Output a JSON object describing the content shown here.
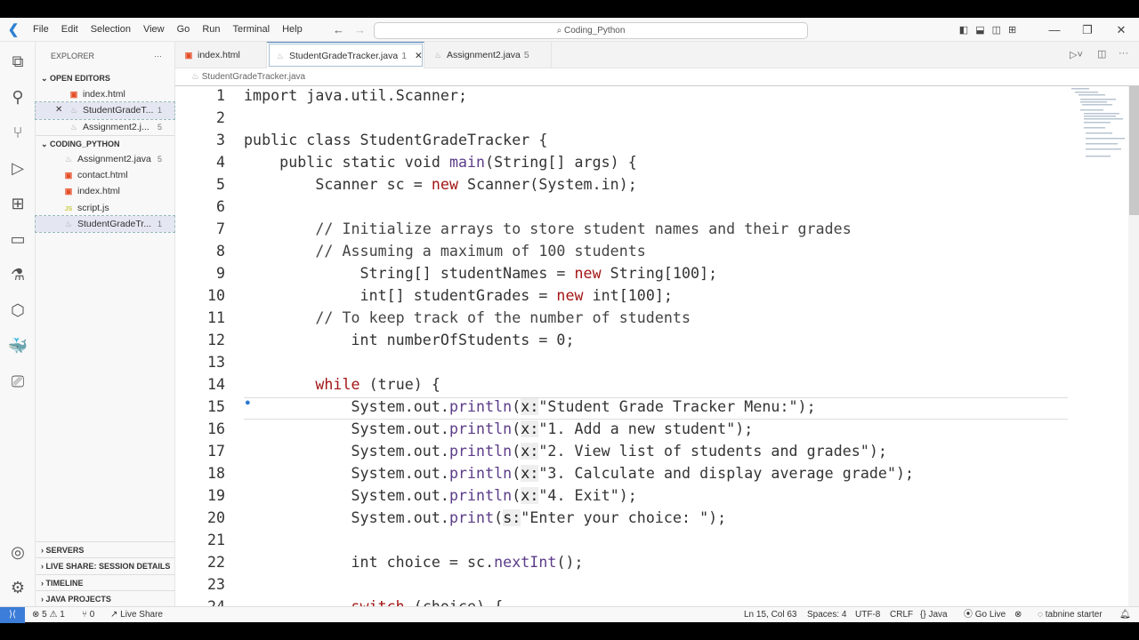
{
  "menu": [
    "File",
    "Edit",
    "Selection",
    "View",
    "Go",
    "Run",
    "Terminal",
    "Help"
  ],
  "search": "Coding_Python",
  "explorer": {
    "title": "EXPLORER",
    "open_editors": "OPEN EDITORS",
    "folder": "CODING_PYTHON",
    "open": [
      {
        "name": "index.html",
        "type": "html",
        "badge": ""
      },
      {
        "name": "StudentGradeT...",
        "type": "java",
        "badge": "1"
      },
      {
        "name": "Assignment2.j...",
        "type": "java",
        "badge": "5"
      }
    ],
    "files": [
      {
        "name": "Assignment2.java",
        "type": "java",
        "badge": "5"
      },
      {
        "name": "contact.html",
        "type": "html",
        "badge": ""
      },
      {
        "name": "index.html",
        "type": "html",
        "badge": ""
      },
      {
        "name": "script.js",
        "type": "js",
        "badge": ""
      },
      {
        "name": "StudentGradeTr...",
        "type": "java",
        "badge": "1"
      }
    ],
    "bottom": [
      "SERVERS",
      "LIVE SHARE: SESSION DETAILS",
      "TIMELINE",
      "JAVA PROJECTS"
    ]
  },
  "tabs": [
    {
      "name": "index.html",
      "badge": ""
    },
    {
      "name": "StudentGradeTracker.java",
      "badge": "1"
    },
    {
      "name": "Assignment2.java",
      "badge": "5"
    }
  ],
  "breadcrumb": "StudentGradeTracker.java",
  "code": [
    [
      [
        "import ",
        "k"
      ],
      [
        "java.util.Scanner;",
        "n"
      ]
    ],
    [],
    [
      [
        "public class ",
        "k"
      ],
      [
        "StudentGradeTracker {",
        "n"
      ]
    ],
    [
      [
        "    public static void ",
        "k"
      ],
      [
        "main",
        "f"
      ],
      [
        "(String[] args) {",
        "n"
      ]
    ],
    [
      [
        "        Scanner sc = ",
        "n"
      ],
      [
        "new",
        "kw"
      ],
      [
        " Scanner(System.in);",
        "n"
      ]
    ],
    [],
    [
      [
        "        // Initialize arrays to store student names and their grades",
        "c"
      ]
    ],
    [
      [
        "        // Assuming a maximum of 100 students",
        "c"
      ]
    ],
    [
      [
        "             String[] studentNames = ",
        "n"
      ],
      [
        "new",
        "kw"
      ],
      [
        " String[100];",
        "n"
      ]
    ],
    [
      [
        "             int[] studentGrades = ",
        "n"
      ],
      [
        "new",
        "kw"
      ],
      [
        " int[100];",
        "n"
      ]
    ],
    [
      [
        "        // To keep track of the number of students",
        "c"
      ]
    ],
    [
      [
        "            int numberOfStudents = 0;",
        "n"
      ]
    ],
    [],
    [
      [
        "        ",
        "n"
      ],
      [
        "while",
        "kw"
      ],
      [
        " (true) {",
        "n"
      ]
    ],
    [
      [
        "            System.out.",
        "n"
      ],
      [
        "println",
        "f"
      ],
      [
        "(",
        "n"
      ],
      [
        "x:",
        "h"
      ],
      [
        "\"Student Grade Tracker Menu:\");",
        "s"
      ]
    ],
    [
      [
        "            System.out.",
        "n"
      ],
      [
        "println",
        "f"
      ],
      [
        "(",
        "n"
      ],
      [
        "x:",
        "h"
      ],
      [
        "\"1. Add a new student\");",
        "s"
      ]
    ],
    [
      [
        "            System.out.",
        "n"
      ],
      [
        "println",
        "f"
      ],
      [
        "(",
        "n"
      ],
      [
        "x:",
        "h"
      ],
      [
        "\"2. View list of students and grades\");",
        "s"
      ]
    ],
    [
      [
        "            System.out.",
        "n"
      ],
      [
        "println",
        "f"
      ],
      [
        "(",
        "n"
      ],
      [
        "x:",
        "h"
      ],
      [
        "\"3. Calculate and display average grade\");",
        "s"
      ]
    ],
    [
      [
        "            System.out.",
        "n"
      ],
      [
        "println",
        "f"
      ],
      [
        "(",
        "n"
      ],
      [
        "x:",
        "h"
      ],
      [
        "\"4. Exit\");",
        "s"
      ]
    ],
    [
      [
        "            System.out.",
        "n"
      ],
      [
        "print",
        "f"
      ],
      [
        "(",
        "n"
      ],
      [
        "s:",
        "h"
      ],
      [
        "\"Enter your choice: \");",
        "s"
      ]
    ],
    [],
    [
      [
        "            int choice = sc.",
        "n"
      ],
      [
        "nextInt",
        "f"
      ],
      [
        "();",
        "n"
      ]
    ],
    [],
    [
      [
        "            ",
        "n"
      ],
      [
        "switch",
        "kw"
      ],
      [
        " (choice) {",
        "n"
      ]
    ]
  ],
  "status": {
    "errors": "5",
    "warnings": "1",
    "ports": "0",
    "liveshare": "Live Share",
    "position": "Ln 15, Col 63",
    "spaces": "Spaces: 4",
    "encoding": "UTF-8",
    "eol": "CRLF",
    "language": "Java",
    "golive": "Go Live",
    "tabnine": "tabnine starter"
  },
  "accent": "#3b7dd8"
}
